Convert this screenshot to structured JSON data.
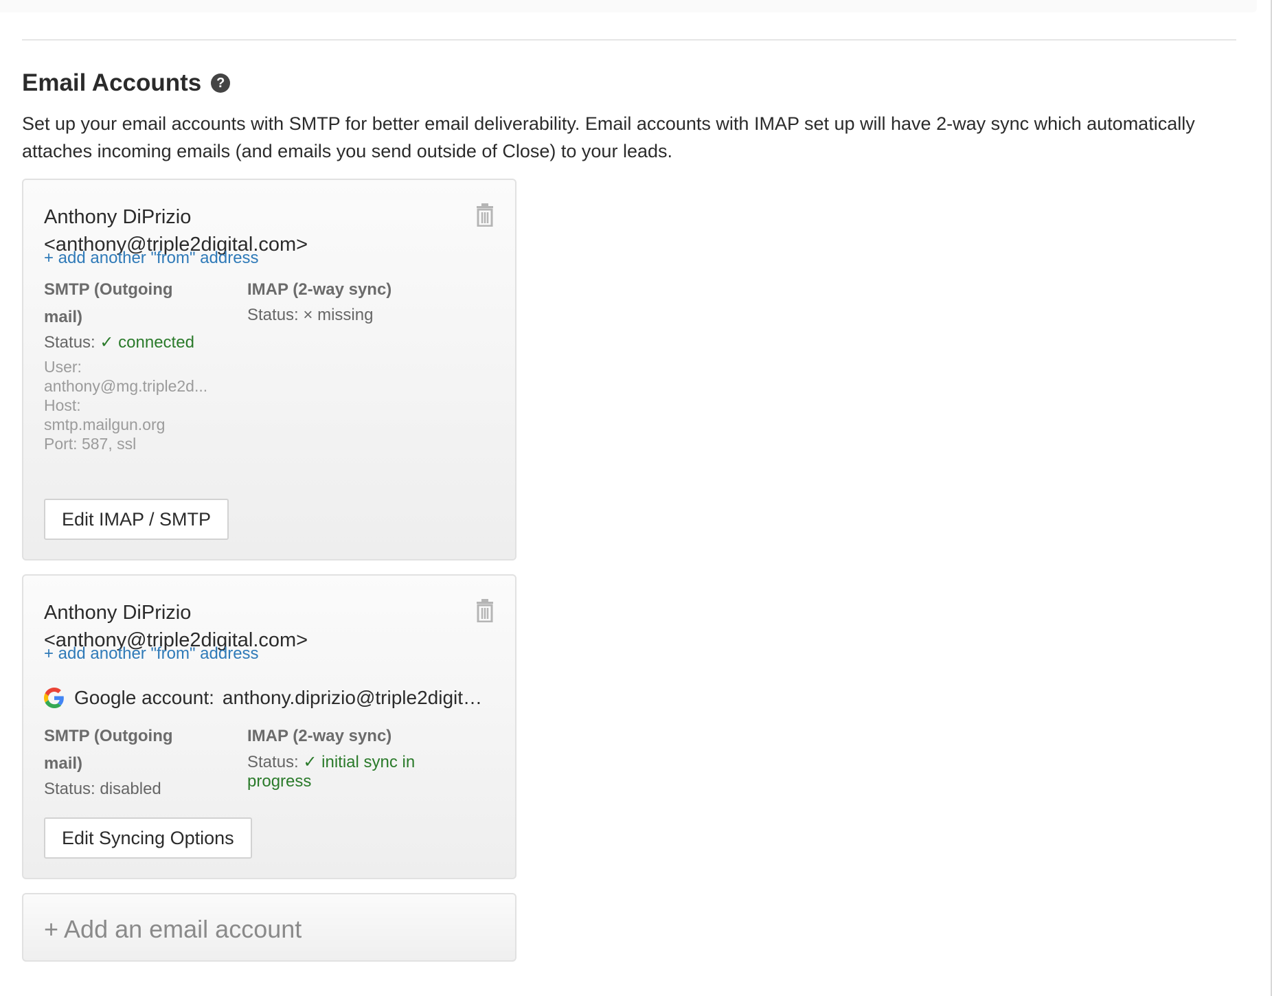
{
  "section": {
    "title": "Email Accounts",
    "help_glyph": "?",
    "description": "Set up your email accounts with SMTP for better email deliverability. Email accounts with IMAP set up will have 2-way sync which automatically attaches incoming emails (and emails you send outside of Close) to your leads."
  },
  "accounts": [
    {
      "name_line1": "Anthony DiPrizio",
      "name_line2": "<anthony@triple2digital.com>",
      "add_from_label": "+ add another \"from\" address",
      "smtp": {
        "heading_line1": "SMTP (Outgoing",
        "heading_line2": "mail)",
        "status_label": "Status:",
        "status_value": "✓ connected",
        "user_label": "User:",
        "user_value": "anthony@mg.triple2d...",
        "host_label": "Host:",
        "host_value": "smtp.mailgun.org",
        "port": "Port: 587, ssl"
      },
      "imap": {
        "heading": "IMAP (2-way sync)",
        "status_label": "Status:",
        "status_value": "× missing"
      },
      "button_label": "Edit IMAP / SMTP",
      "delete_icon": "trash-icon"
    },
    {
      "name_line1": "Anthony DiPrizio",
      "name_line2": "<anthony@triple2digital.com>",
      "add_from_label": "+ add another \"from\" address",
      "google": {
        "label": "Google account:",
        "email": "anthony.diprizio@triple2digital.com"
      },
      "smtp": {
        "heading_line1": "SMTP (Outgoing",
        "heading_line2": "mail)",
        "status": "Status: disabled"
      },
      "imap": {
        "heading": "IMAP (2-way sync)",
        "status_label": "Status:",
        "status_value_line1": "✓ initial sync in",
        "status_value_line2": "progress"
      },
      "button_label": "Edit Syncing Options",
      "delete_icon": "trash-icon"
    }
  ],
  "add_account_label": "+ Add an email account",
  "colors": {
    "link": "#2f7ab8",
    "success": "#2a7a2a",
    "muted": "#9b9b9b"
  }
}
